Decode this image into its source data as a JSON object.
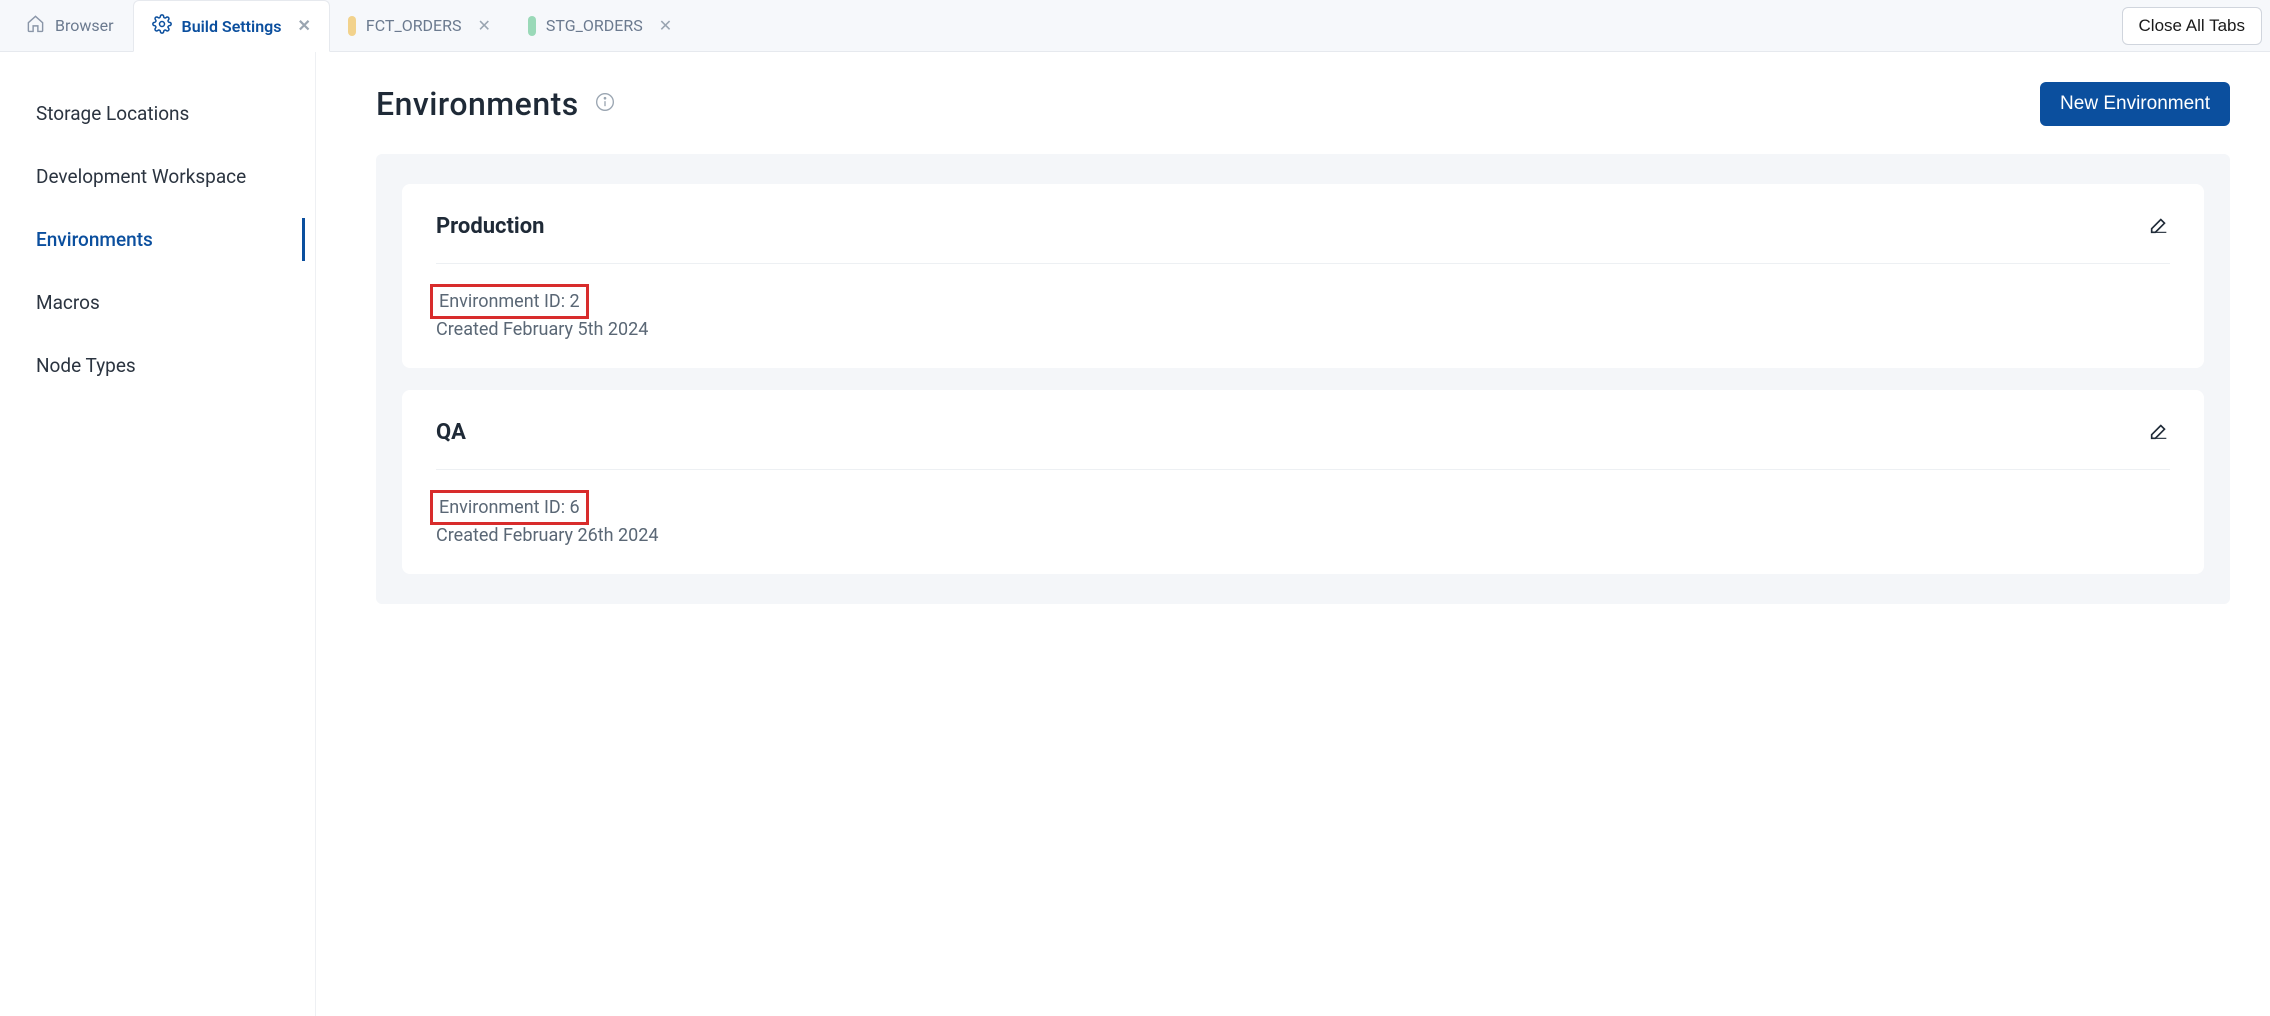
{
  "tabs": {
    "browser": {
      "label": "Browser"
    },
    "build_settings": {
      "label": "Build Settings"
    },
    "fct_orders": {
      "label": "FCT_ORDERS",
      "swatch": "#f2d28c"
    },
    "stg_orders": {
      "label": "STG_ORDERS",
      "swatch": "#9ad9b8"
    },
    "close_all": "Close All Tabs"
  },
  "sidebar": {
    "items": [
      {
        "label": "Storage Locations"
      },
      {
        "label": "Development Workspace"
      },
      {
        "label": "Environments"
      },
      {
        "label": "Macros"
      },
      {
        "label": "Node Types"
      }
    ]
  },
  "page": {
    "title": "Environments",
    "new_button": "New Environment"
  },
  "environments": [
    {
      "name": "Production",
      "id_label": "Environment ID: 2",
      "created": "Created February 5th 2024",
      "highlight": true
    },
    {
      "name": "QA",
      "id_label": "Environment ID: 6",
      "created": "Created February 26th 2024",
      "highlight": true
    }
  ]
}
